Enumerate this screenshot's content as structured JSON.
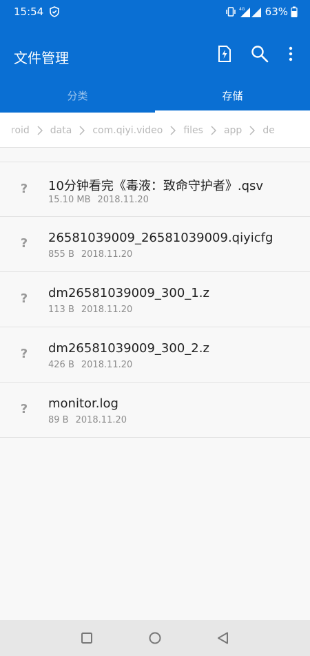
{
  "status_bar": {
    "time": "15:54",
    "battery": "63%",
    "network": "4G",
    "icons": [
      "notification-shield-icon",
      "vibrate-icon",
      "signal-icon",
      "battery-icon"
    ]
  },
  "app": {
    "title": "文件管理",
    "accent": "#0a6fd3",
    "toolbar_icons": [
      "storage-clean-icon",
      "search-icon",
      "more-vert-icon"
    ]
  },
  "tabs": [
    {
      "label": "分类",
      "active": false
    },
    {
      "label": "存储",
      "active": true
    }
  ],
  "breadcrumb": [
    "roid",
    "data",
    "com.qiyi.video",
    "files",
    "app",
    "de"
  ],
  "files": [
    {
      "name": "10分钟看完《毒液：致命守护者》.qsv",
      "size": "15.10 MB",
      "date": "2018.11.20"
    },
    {
      "name": "26581039009_26581039009.qiyicfg",
      "size": "855 B",
      "date": "2018.11.20"
    },
    {
      "name": "dm26581039009_300_1.z",
      "size": "113 B",
      "date": "2018.11.20"
    },
    {
      "name": "dm26581039009_300_2.z",
      "size": "426 B",
      "date": "2018.11.20"
    },
    {
      "name": "monitor.log",
      "size": "89 B",
      "date": "2018.11.20"
    }
  ],
  "unknown_file_glyph": "?",
  "nav_bar": [
    "recents-icon",
    "home-icon",
    "back-icon"
  ]
}
